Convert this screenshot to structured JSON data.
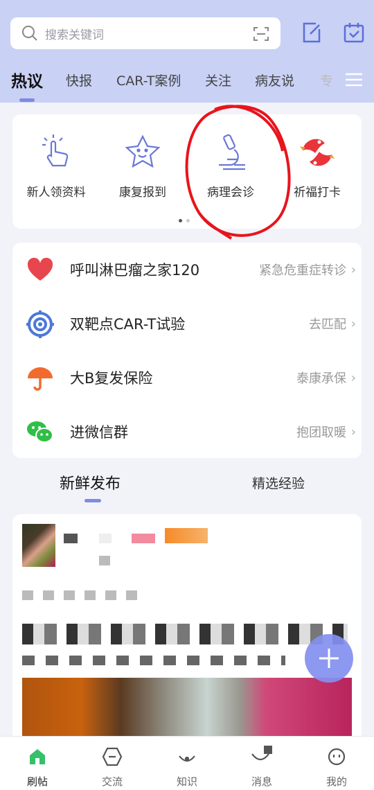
{
  "search": {
    "placeholder": "搜索关键词"
  },
  "tabs": [
    {
      "label": "热议"
    },
    {
      "label": "快报"
    },
    {
      "label": "CAR-T案例"
    },
    {
      "label": "关注"
    },
    {
      "label": "病友说"
    },
    {
      "label": "专"
    }
  ],
  "quick_actions": [
    {
      "label": "新人领资料",
      "icon": "tap-hand-icon"
    },
    {
      "label": "康复报到",
      "icon": "star-face-icon"
    },
    {
      "label": "病理会诊",
      "icon": "microscope-icon"
    },
    {
      "label": "祈福打卡",
      "icon": "koi-fish-icon"
    }
  ],
  "service_rows": [
    {
      "title": "呼叫淋巴瘤之家120",
      "right": "紧急危重症转诊",
      "icon": "heart-icon",
      "color": "#e8464e"
    },
    {
      "title": "双靶点CAR-T试验",
      "right": "去匹配",
      "icon": "target-icon",
      "color": "#4d78d8"
    },
    {
      "title": "大B复发保险",
      "right": "泰康承保",
      "icon": "umbrella-icon",
      "color": "#f26a2e"
    },
    {
      "title": "进微信群",
      "right": "抱团取暖",
      "icon": "wechat-icon",
      "color": "#2fbf46"
    }
  ],
  "feed_tabs": [
    {
      "label": "新鲜发布"
    },
    {
      "label": "精选经验"
    }
  ],
  "bottom_nav": [
    {
      "label": "刷帖",
      "icon": "home-icon"
    },
    {
      "label": "交流",
      "icon": "chat-icon"
    },
    {
      "label": "知识",
      "icon": "book-icon"
    },
    {
      "label": "消息",
      "icon": "message-icon"
    },
    {
      "label": "我的",
      "icon": "profile-icon"
    }
  ],
  "colors": {
    "accent": "#7d8be0",
    "header_bg": "#c9d1f5",
    "annotation": "#e8141c"
  }
}
